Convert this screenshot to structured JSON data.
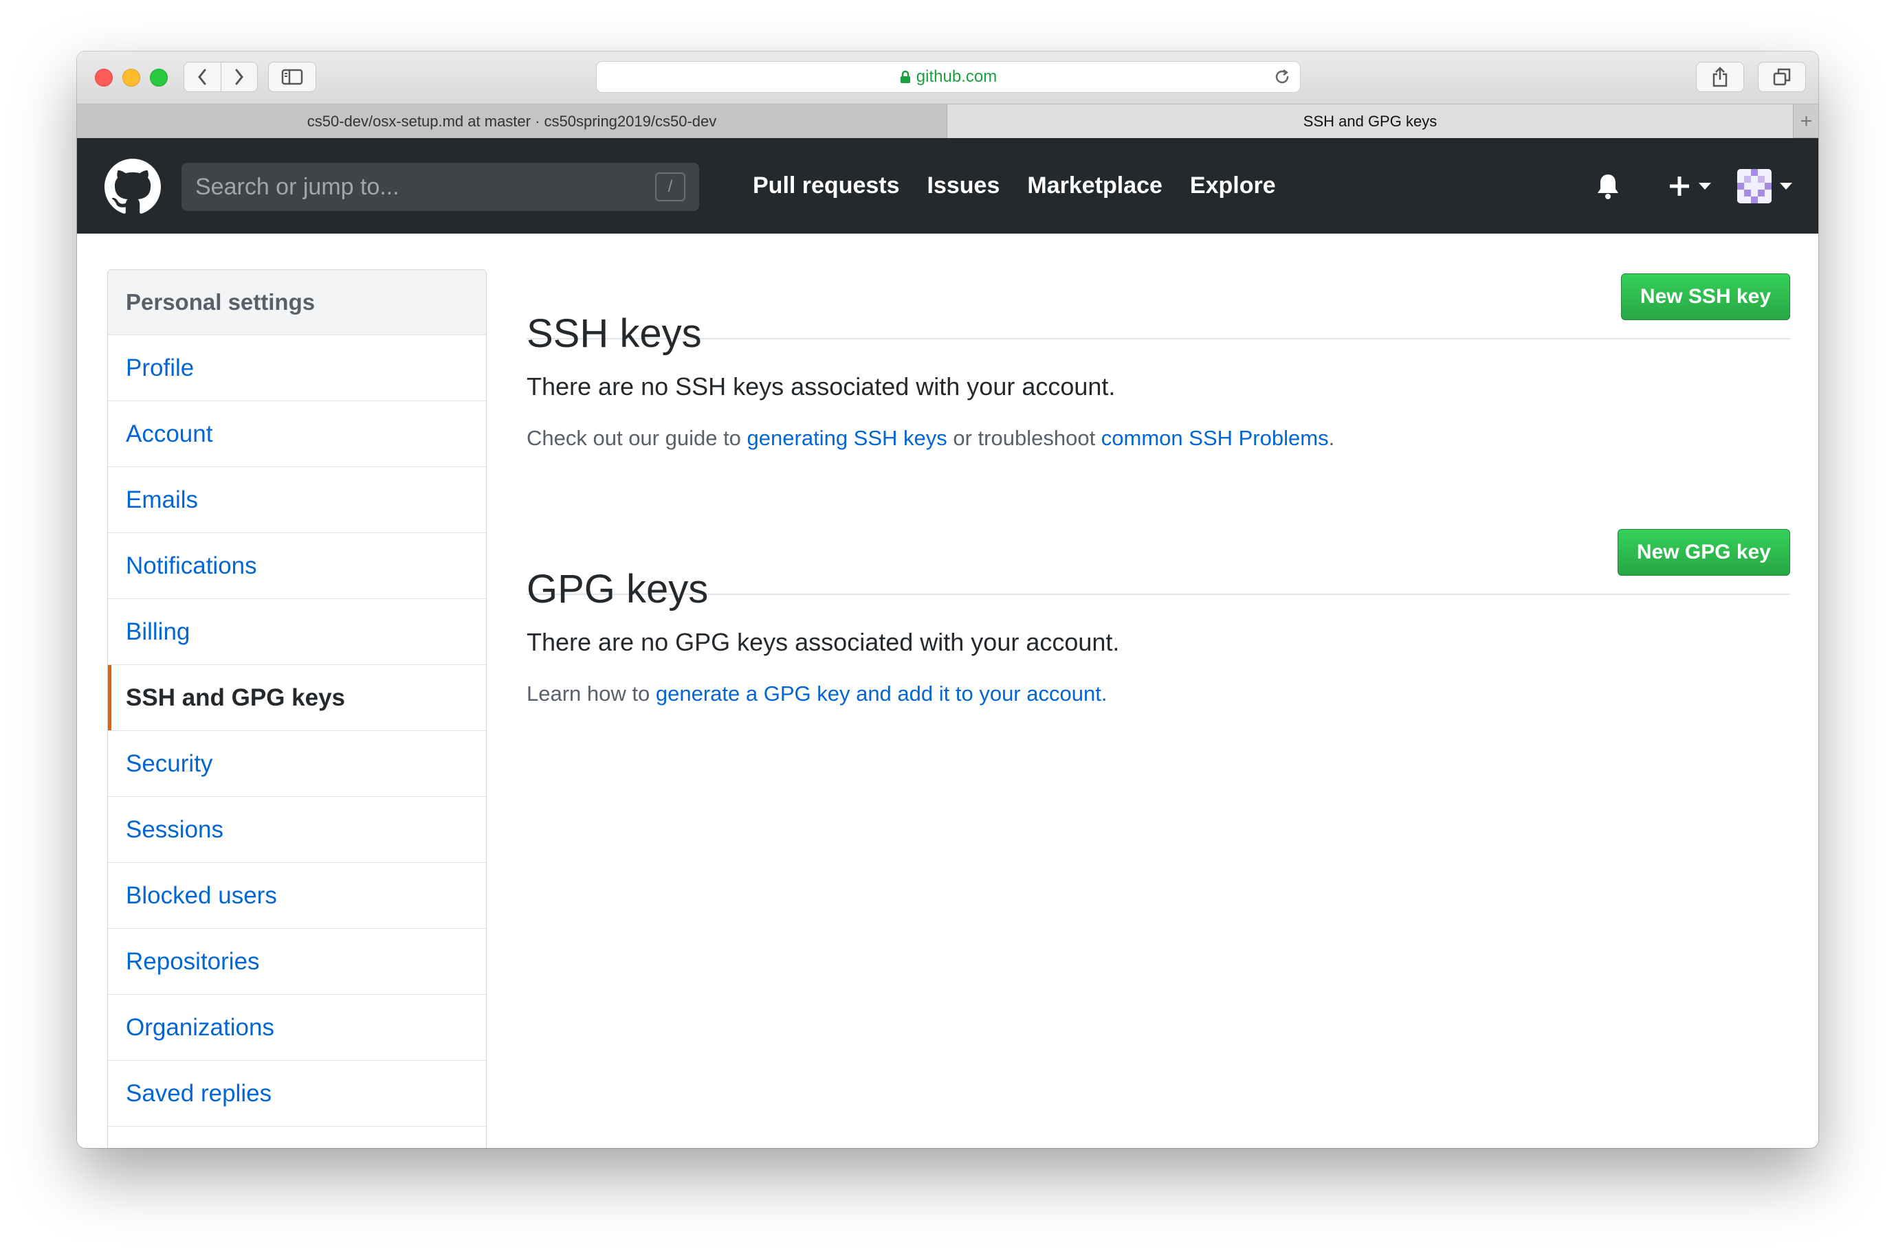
{
  "browser": {
    "url": "github.com",
    "tabs": [
      {
        "label": "cs50-dev/osx-setup.md at master · cs50spring2019/cs50-dev"
      },
      {
        "label": "SSH and GPG keys"
      }
    ],
    "new_tab_label": "+"
  },
  "header": {
    "search_placeholder": "Search or jump to...",
    "search_shortcut": "/",
    "nav": [
      "Pull requests",
      "Issues",
      "Marketplace",
      "Explore"
    ]
  },
  "menu": {
    "heading": "Personal settings",
    "items": [
      {
        "label": "Profile"
      },
      {
        "label": "Account"
      },
      {
        "label": "Emails"
      },
      {
        "label": "Notifications"
      },
      {
        "label": "Billing"
      },
      {
        "label": "SSH and GPG keys",
        "selected": true
      },
      {
        "label": "Security"
      },
      {
        "label": "Sessions"
      },
      {
        "label": "Blocked users"
      },
      {
        "label": "Repositories"
      },
      {
        "label": "Organizations"
      },
      {
        "label": "Saved replies"
      }
    ]
  },
  "ssh": {
    "title": "SSH keys",
    "button": "New SSH key",
    "blank_title": "There are no SSH keys associated with your account.",
    "help_prefix": "Check out our guide to ",
    "help_link1": "generating SSH keys",
    "help_middle": " or troubleshoot ",
    "help_link2": "common SSH Problems",
    "help_suffix": "."
  },
  "gpg": {
    "title": "GPG keys",
    "button": "New GPG key",
    "blank_title": "There are no GPG keys associated with your account.",
    "help_prefix": "Learn how to ",
    "help_link": "generate a GPG key and add it to your account."
  },
  "colors": {
    "header_bg": "#24292e",
    "link": "#0366d6",
    "button_green": "#28a745",
    "selected_accent": "#e36209"
  }
}
